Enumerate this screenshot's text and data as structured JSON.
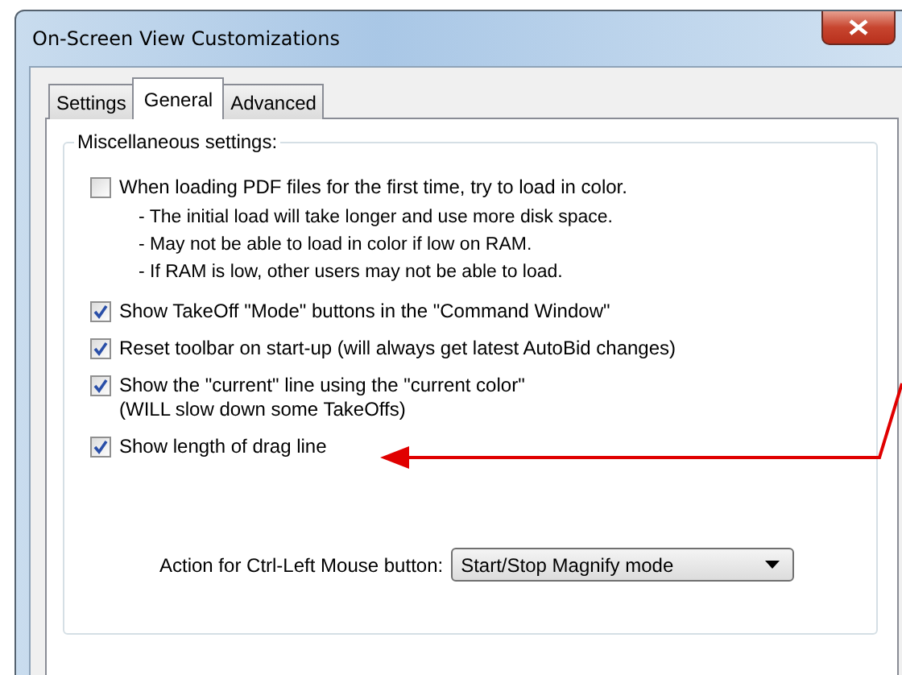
{
  "window": {
    "title": "On-Screen View Customizations"
  },
  "tabs": [
    {
      "label": "Settings",
      "selected": false
    },
    {
      "label": "General",
      "selected": true
    },
    {
      "label": "Advanced",
      "selected": false
    }
  ],
  "group": {
    "title": "Miscellaneous settings:"
  },
  "options": [
    {
      "label": "When loading PDF files for the first time, try to load in color.",
      "checked": false,
      "notes": [
        "- The initial load will take longer and use more disk space.",
        "- May not be able to load in color if low on RAM.",
        "- If RAM is low, other users may not be able to load."
      ]
    },
    {
      "label": "Show TakeOff \"Mode\" buttons in the \"Command Window\"",
      "checked": true
    },
    {
      "label": "Reset toolbar on start-up (will always get latest AutoBid changes)",
      "checked": true
    },
    {
      "label": "Show the \"current\" line using the \"current color\"\n(WILL slow down some TakeOffs)",
      "checked": true
    },
    {
      "label": "Show length of drag line",
      "checked": true
    }
  ],
  "action": {
    "label": "Action for Ctrl-Left Mouse button:",
    "value": "Start/Stop Magnify mode"
  }
}
